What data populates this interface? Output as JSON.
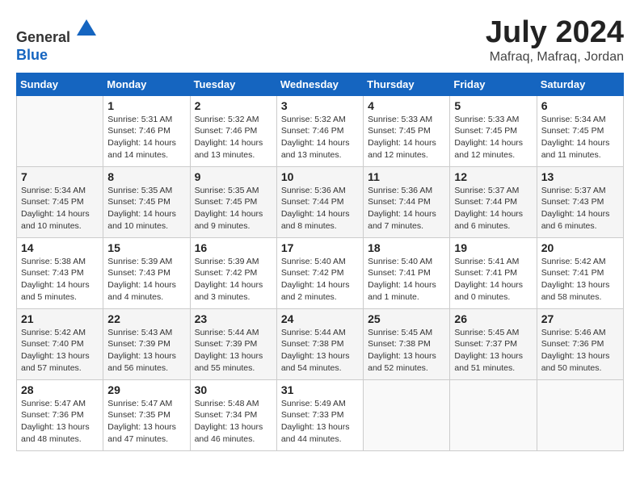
{
  "header": {
    "logo_line1": "General",
    "logo_line2": "Blue",
    "month_year": "July 2024",
    "location": "Mafraq, Mafraq, Jordan"
  },
  "days_of_week": [
    "Sunday",
    "Monday",
    "Tuesday",
    "Wednesday",
    "Thursday",
    "Friday",
    "Saturday"
  ],
  "weeks": [
    [
      {
        "day": "",
        "info": ""
      },
      {
        "day": "1",
        "info": "Sunrise: 5:31 AM\nSunset: 7:46 PM\nDaylight: 14 hours\nand 14 minutes."
      },
      {
        "day": "2",
        "info": "Sunrise: 5:32 AM\nSunset: 7:46 PM\nDaylight: 14 hours\nand 13 minutes."
      },
      {
        "day": "3",
        "info": "Sunrise: 5:32 AM\nSunset: 7:46 PM\nDaylight: 14 hours\nand 13 minutes."
      },
      {
        "day": "4",
        "info": "Sunrise: 5:33 AM\nSunset: 7:45 PM\nDaylight: 14 hours\nand 12 minutes."
      },
      {
        "day": "5",
        "info": "Sunrise: 5:33 AM\nSunset: 7:45 PM\nDaylight: 14 hours\nand 12 minutes."
      },
      {
        "day": "6",
        "info": "Sunrise: 5:34 AM\nSunset: 7:45 PM\nDaylight: 14 hours\nand 11 minutes."
      }
    ],
    [
      {
        "day": "7",
        "info": "Sunrise: 5:34 AM\nSunset: 7:45 PM\nDaylight: 14 hours\nand 10 minutes."
      },
      {
        "day": "8",
        "info": "Sunrise: 5:35 AM\nSunset: 7:45 PM\nDaylight: 14 hours\nand 10 minutes."
      },
      {
        "day": "9",
        "info": "Sunrise: 5:35 AM\nSunset: 7:45 PM\nDaylight: 14 hours\nand 9 minutes."
      },
      {
        "day": "10",
        "info": "Sunrise: 5:36 AM\nSunset: 7:44 PM\nDaylight: 14 hours\nand 8 minutes."
      },
      {
        "day": "11",
        "info": "Sunrise: 5:36 AM\nSunset: 7:44 PM\nDaylight: 14 hours\nand 7 minutes."
      },
      {
        "day": "12",
        "info": "Sunrise: 5:37 AM\nSunset: 7:44 PM\nDaylight: 14 hours\nand 6 minutes."
      },
      {
        "day": "13",
        "info": "Sunrise: 5:37 AM\nSunset: 7:43 PM\nDaylight: 14 hours\nand 6 minutes."
      }
    ],
    [
      {
        "day": "14",
        "info": "Sunrise: 5:38 AM\nSunset: 7:43 PM\nDaylight: 14 hours\nand 5 minutes."
      },
      {
        "day": "15",
        "info": "Sunrise: 5:39 AM\nSunset: 7:43 PM\nDaylight: 14 hours\nand 4 minutes."
      },
      {
        "day": "16",
        "info": "Sunrise: 5:39 AM\nSunset: 7:42 PM\nDaylight: 14 hours\nand 3 minutes."
      },
      {
        "day": "17",
        "info": "Sunrise: 5:40 AM\nSunset: 7:42 PM\nDaylight: 14 hours\nand 2 minutes."
      },
      {
        "day": "18",
        "info": "Sunrise: 5:40 AM\nSunset: 7:41 PM\nDaylight: 14 hours\nand 1 minute."
      },
      {
        "day": "19",
        "info": "Sunrise: 5:41 AM\nSunset: 7:41 PM\nDaylight: 14 hours\nand 0 minutes."
      },
      {
        "day": "20",
        "info": "Sunrise: 5:42 AM\nSunset: 7:41 PM\nDaylight: 13 hours\nand 58 minutes."
      }
    ],
    [
      {
        "day": "21",
        "info": "Sunrise: 5:42 AM\nSunset: 7:40 PM\nDaylight: 13 hours\nand 57 minutes."
      },
      {
        "day": "22",
        "info": "Sunrise: 5:43 AM\nSunset: 7:39 PM\nDaylight: 13 hours\nand 56 minutes."
      },
      {
        "day": "23",
        "info": "Sunrise: 5:44 AM\nSunset: 7:39 PM\nDaylight: 13 hours\nand 55 minutes."
      },
      {
        "day": "24",
        "info": "Sunrise: 5:44 AM\nSunset: 7:38 PM\nDaylight: 13 hours\nand 54 minutes."
      },
      {
        "day": "25",
        "info": "Sunrise: 5:45 AM\nSunset: 7:38 PM\nDaylight: 13 hours\nand 52 minutes."
      },
      {
        "day": "26",
        "info": "Sunrise: 5:45 AM\nSunset: 7:37 PM\nDaylight: 13 hours\nand 51 minutes."
      },
      {
        "day": "27",
        "info": "Sunrise: 5:46 AM\nSunset: 7:36 PM\nDaylight: 13 hours\nand 50 minutes."
      }
    ],
    [
      {
        "day": "28",
        "info": "Sunrise: 5:47 AM\nSunset: 7:36 PM\nDaylight: 13 hours\nand 48 minutes."
      },
      {
        "day": "29",
        "info": "Sunrise: 5:47 AM\nSunset: 7:35 PM\nDaylight: 13 hours\nand 47 minutes."
      },
      {
        "day": "30",
        "info": "Sunrise: 5:48 AM\nSunset: 7:34 PM\nDaylight: 13 hours\nand 46 minutes."
      },
      {
        "day": "31",
        "info": "Sunrise: 5:49 AM\nSunset: 7:33 PM\nDaylight: 13 hours\nand 44 minutes."
      },
      {
        "day": "",
        "info": ""
      },
      {
        "day": "",
        "info": ""
      },
      {
        "day": "",
        "info": ""
      }
    ]
  ]
}
